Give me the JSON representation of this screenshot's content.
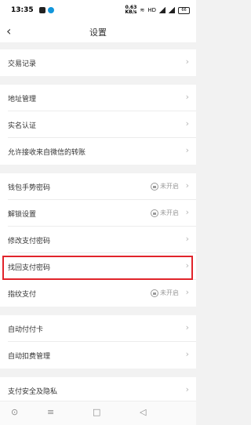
{
  "status_bar": {
    "time": "13:35",
    "speed_value": "0.63",
    "speed_unit": "KB/s",
    "network": "HD",
    "battery": "66"
  },
  "header": {
    "title": "设置"
  },
  "groups": [
    [
      {
        "label": "交易记录"
      }
    ],
    [
      {
        "label": "地址管理"
      },
      {
        "label": "实名认证"
      },
      {
        "label": "允许接收来自微信的转账"
      }
    ],
    [
      {
        "label": "钱包手势密码",
        "status": "未开启"
      },
      {
        "label": "解锁设置",
        "status": "未开启"
      },
      {
        "label": "修改支付密码"
      },
      {
        "label": "找回支付密码"
      },
      {
        "label": "指纹支付",
        "status": "未开启"
      }
    ],
    [
      {
        "label": "自动付付卡"
      },
      {
        "label": "自动扣费管理"
      }
    ],
    [
      {
        "label": "支付安全及隐私"
      }
    ]
  ],
  "colors": {
    "highlight": "#e1242b"
  }
}
